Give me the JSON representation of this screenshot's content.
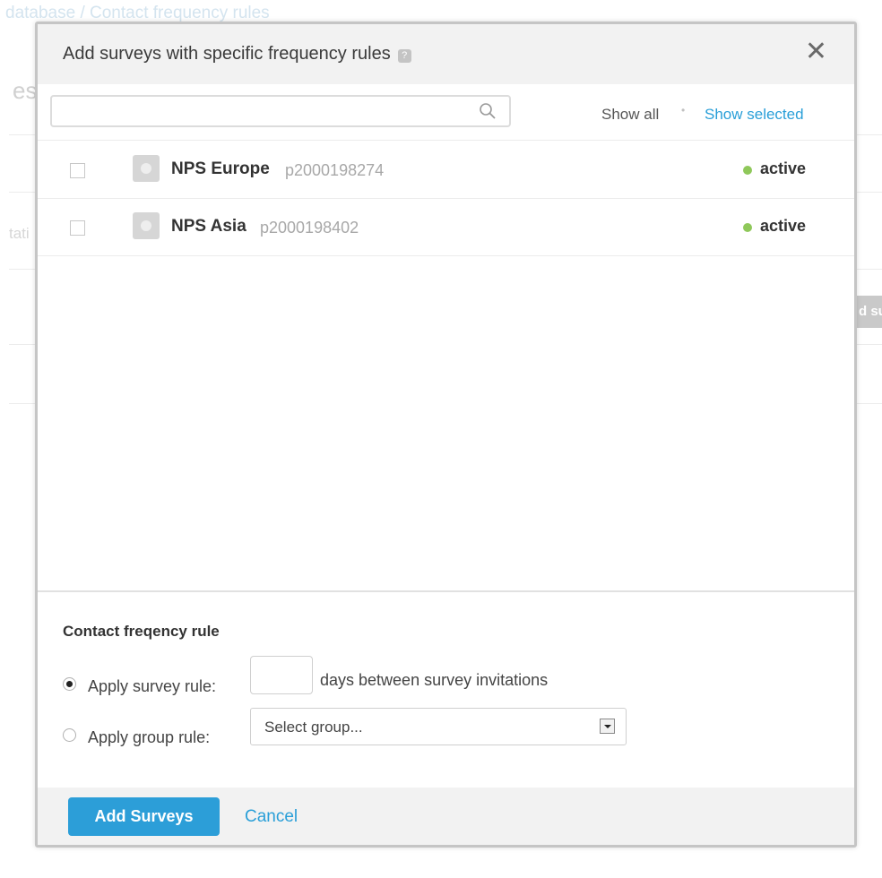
{
  "background": {
    "breadcrumb": "database / Contact frequency rules",
    "heading": "es",
    "label": "tati",
    "button": "d su"
  },
  "modal": {
    "title": "Add surveys with specific frequency rules",
    "help_icon": "question-icon",
    "close_icon": "close-icon",
    "search": {
      "placeholder": "",
      "value": ""
    },
    "filters": {
      "show_all": "Show all",
      "separator": "•",
      "show_selected": "Show selected"
    },
    "surveys": [
      {
        "name": "NPS Europe",
        "id": "p2000198274",
        "status": "active",
        "checked": false
      },
      {
        "name": "NPS Asia",
        "id": "p2000198402",
        "status": "active",
        "checked": false
      }
    ],
    "rules": {
      "heading": "Contact freqency rule",
      "survey_rule_label": "Apply survey rule:",
      "days_value": "",
      "days_label": "days between survey invitations",
      "group_rule_label": "Apply group rule:",
      "group_select_value": "Select group...",
      "selected_option": "survey"
    },
    "footer": {
      "add_button": "Add Surveys",
      "cancel": "Cancel"
    }
  },
  "colors": {
    "accent": "#2c9ed8",
    "status_active": "#8fc85a",
    "header_bg": "#f2f2f2"
  }
}
